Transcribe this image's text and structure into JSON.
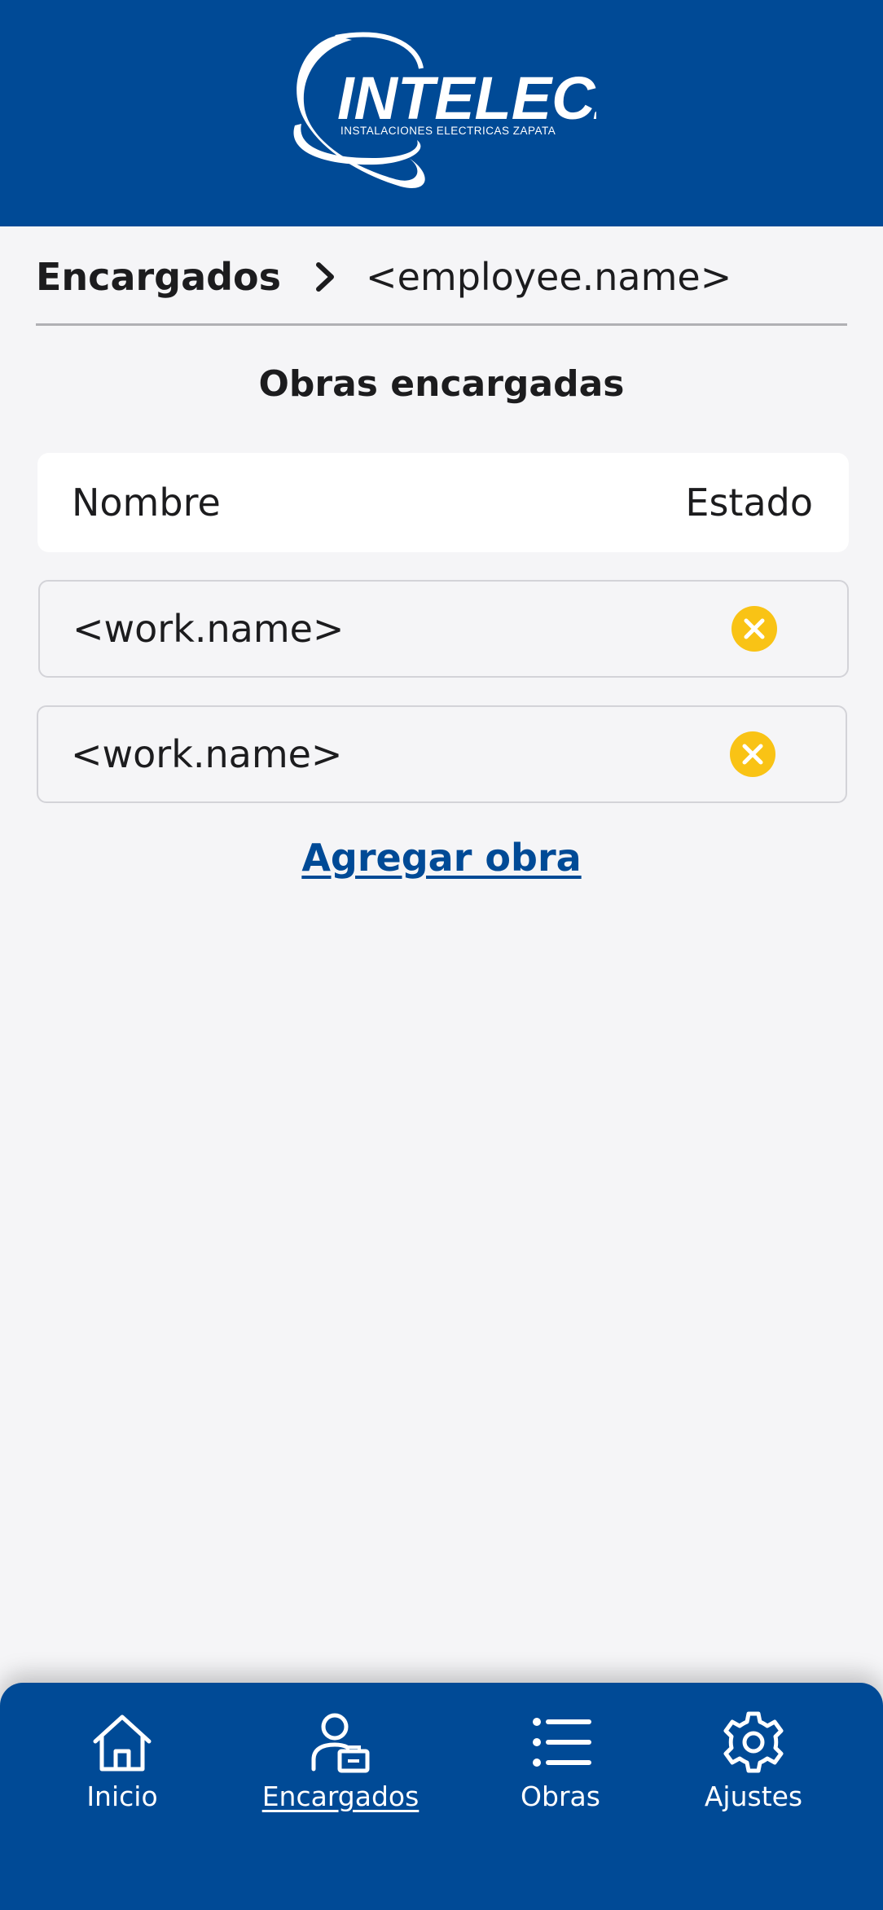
{
  "header": {
    "brand": "INTELECZA",
    "tagline": "INSTALACIONES ELECTRICAS ZAPATA"
  },
  "breadcrumb": {
    "root": "Encargados",
    "current": "<employee.name>"
  },
  "section_title": "Obras encargadas",
  "table": {
    "columns": [
      "Nombre",
      "Estado"
    ],
    "rows": [
      {
        "name": "<work.name>",
        "status_icon": "x-circle-icon"
      },
      {
        "name": "<work.name>",
        "status_icon": "x-circle-icon"
      }
    ]
  },
  "add_link": "Agregar obra",
  "nav": {
    "items": [
      {
        "label": "Inicio",
        "icon": "home-icon"
      },
      {
        "label": "Encargados",
        "icon": "supervisor-icon",
        "active": true
      },
      {
        "label": "Obras",
        "icon": "list-icon"
      },
      {
        "label": "Ajustes",
        "icon": "gear-icon"
      }
    ]
  },
  "colors": {
    "brand_blue": "#004a96",
    "status_yellow": "#f9c315",
    "background": "#f5f5f7"
  }
}
